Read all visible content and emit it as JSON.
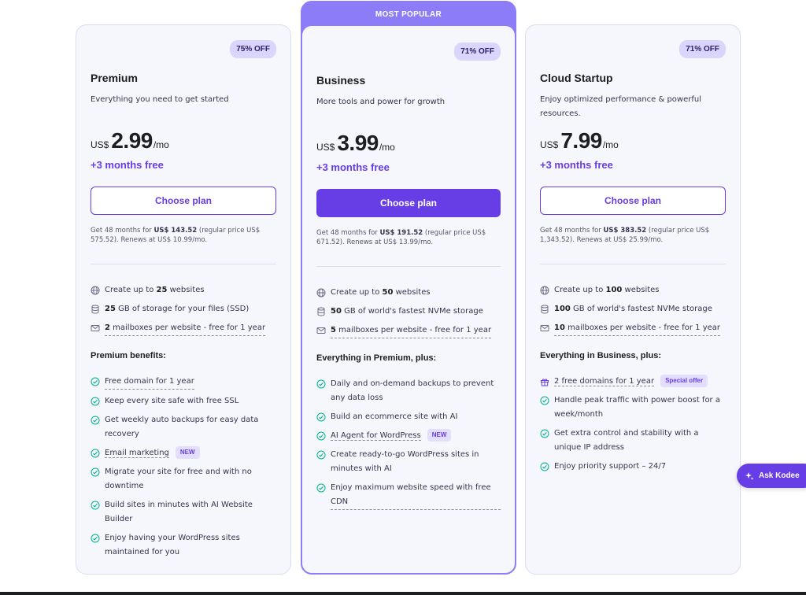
{
  "colors": {
    "accent": "#673de6",
    "popular_border": "#8c7cf7",
    "badge_bg": "#d9d5fc",
    "card_bg": "#f6f6fd",
    "check_green": "#00b090"
  },
  "plans": [
    {
      "name": "Premium",
      "badge": "75% OFF",
      "description": "Everything you need to get started",
      "currency": "US$",
      "price": "2.99",
      "period": "/mo",
      "free_months": "+3 months free",
      "button": "Choose plan",
      "renew_prefix": "Get 48 months for ",
      "renew_amount": "US$ 143.52",
      "renew_suffix": " (regular price US$ 575.52). Renews at US$ 10.99/mo.",
      "features": [
        {
          "icon": "globe-icon",
          "bold": "",
          "pre": "Create up to ",
          "strong": "25",
          "post": " websites",
          "dashed": false
        },
        {
          "icon": "database-icon",
          "pre": "",
          "strong": "25",
          "post": " GB of storage for your files (SSD)",
          "dashed": false
        },
        {
          "icon": "mail-icon",
          "pre": "",
          "strong": "2",
          "post": " mailboxes per website - free for 1 year",
          "dashed": true
        }
      ],
      "section_title": "Premium benefits:",
      "benefits": [
        {
          "text": "Free domain for 1 year",
          "dashed": true,
          "tag": ""
        },
        {
          "text": "Keep every site safe with free SSL",
          "dashed": false,
          "tag": ""
        },
        {
          "text": "Get weekly auto backups for easy data recovery",
          "dashed": false,
          "tag": ""
        },
        {
          "text": "Email marketing",
          "dashed": true,
          "tag": "NEW"
        },
        {
          "text": "Migrate your site for free and with no downtime",
          "dashed": false,
          "tag": ""
        },
        {
          "text": "Build sites in minutes with AI Website Builder",
          "dashed": false,
          "tag": ""
        },
        {
          "text": "Enjoy having your WordPress sites maintained for you",
          "dashed": false,
          "tag": ""
        }
      ]
    },
    {
      "name": "Business",
      "popular_label": "MOST POPULAR",
      "badge": "71% OFF",
      "description": "More tools and power for growth",
      "currency": "US$",
      "price": "3.99",
      "period": "/mo",
      "free_months": "+3 months free",
      "button": "Choose plan",
      "renew_prefix": "Get 48 months for ",
      "renew_amount": "US$ 191.52",
      "renew_suffix": " (regular price US$ 671.52). Renews at US$ 13.99/mo.",
      "features": [
        {
          "icon": "globe-icon",
          "pre": "Create up to ",
          "strong": "50",
          "post": " websites",
          "dashed": false
        },
        {
          "icon": "database-icon",
          "pre": "",
          "strong": "50",
          "post": " GB of world's fastest NVMe storage",
          "dashed": false
        },
        {
          "icon": "mail-icon",
          "pre": "",
          "strong": "5",
          "post": " mailboxes per website - free for 1 year",
          "dashed": true
        }
      ],
      "section_title": "Everything in Premium, plus:",
      "benefits": [
        {
          "text": "Daily and on-demand backups to prevent any data loss",
          "dashed": false,
          "tag": ""
        },
        {
          "text": "Build an ecommerce site with AI",
          "dashed": false,
          "tag": ""
        },
        {
          "text": "AI Agent for WordPress",
          "dashed": true,
          "tag": "NEW"
        },
        {
          "text": "Create ready-to-go WordPress sites in minutes with AI",
          "dashed": false,
          "tag": ""
        },
        {
          "text": "Enjoy maximum website speed with free CDN",
          "dashed": true,
          "tag": ""
        }
      ]
    },
    {
      "name": "Cloud Startup",
      "badge": "71% OFF",
      "description": "Enjoy optimized performance & powerful resources.",
      "currency": "US$",
      "price": "7.99",
      "period": "/mo",
      "free_months": "+3 months free",
      "button": "Choose plan",
      "renew_prefix": "Get 48 months for ",
      "renew_amount": "US$ 383.52",
      "renew_suffix": " (regular price US$ 1,343.52). Renews at US$ 25.99/mo.",
      "features": [
        {
          "icon": "globe-icon",
          "pre": "Create up to ",
          "strong": "100",
          "post": " websites",
          "dashed": false
        },
        {
          "icon": "database-icon",
          "pre": "",
          "strong": "100",
          "post": " GB of world's fastest NVMe storage",
          "dashed": false
        },
        {
          "icon": "mail-icon",
          "pre": "",
          "strong": "10",
          "post": " mailboxes per website - free for 1 year",
          "dashed": true
        }
      ],
      "section_title": "Everything in Business, plus:",
      "benefits": [
        {
          "text": "2 free domains for 1 year",
          "dashed": true,
          "tag": "Special offer",
          "icon": "gift-icon"
        },
        {
          "text": "Handle peak traffic with power boost for a week/month",
          "dashed": false,
          "tag": ""
        },
        {
          "text": "Get extra control and stability with a unique IP address",
          "dashed": false,
          "tag": ""
        },
        {
          "text": "Enjoy priority support – 24/7",
          "dashed": false,
          "tag": ""
        }
      ]
    }
  ],
  "assistant": {
    "label": "Ask Kodee",
    "icon": "sparkle-icon"
  }
}
